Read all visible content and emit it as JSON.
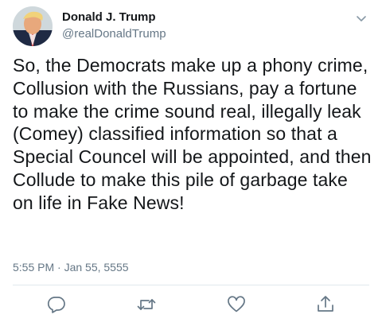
{
  "user": {
    "display_name": "Donald J. Trump",
    "handle": "@realDonaldTrump",
    "avatar_icon": "profile-photo"
  },
  "tweet": {
    "text": "So, the Democrats make up a phony crime, Collusion with the Russians, pay a fortune to make the crime sound real, illegally leak (Comey) classified information so that a Special Councel will be appointed, and then Collude to make this pile of garbage take on life in Fake News!",
    "timestamp": "5:55 PM · Jan 55, 5555"
  },
  "actions": [
    {
      "icon": "reply-icon"
    },
    {
      "icon": "retweet-icon"
    },
    {
      "icon": "like-icon"
    },
    {
      "icon": "share-icon"
    }
  ],
  "colors": {
    "text_primary": "#14171a",
    "text_secondary": "#657786",
    "icon": "#657786",
    "divider": "#e1e8ed"
  }
}
